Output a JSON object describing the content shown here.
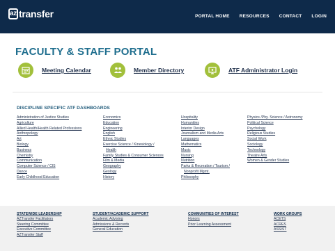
{
  "header": {
    "logo_box": "az",
    "logo_text": "transfer",
    "nav": [
      "PORTAL HOME",
      "RESOURCES",
      "CONTACT",
      "LOGIN"
    ]
  },
  "page_title": "FACULTY & STAFF PORTAL",
  "quick_links": [
    {
      "label": "Meeting Calendar",
      "icon": "calendar-icon"
    },
    {
      "label": "Member Directory",
      "icon": "people-icon"
    },
    {
      "label": "ATF Administrator Login",
      "icon": "admin-login-icon"
    }
  ],
  "dashboards": {
    "title": "DISCIPLINE SPECIFIC ATF DASHBOARDS",
    "columns": [
      [
        "Administration of Justice Studies",
        "Agriculture",
        "Allied Health/Health Related Professions",
        "Anthropology",
        "Art",
        "Biology",
        "Business",
        "Chemistry",
        "Communication",
        "Computer Science / CIS",
        "Dance",
        "Early Childhood Education"
      ],
      [
        "Economics",
        "Education",
        "Engineering",
        "English",
        "Ethnic Studies",
        "Exercise Science / Kinesiology /",
        "Health",
        "Family Studies & Consumer Sciences",
        "Film & Media",
        "Geography",
        "Geology",
        "History"
      ],
      [
        "Hospitality",
        "Humanities",
        "Interior Design",
        "Journalism and Media Arts",
        "Languages",
        "Mathematics",
        "Music",
        "Nursing",
        "Nutrition",
        "Parks & Recreation / Tourism /",
        "Nonprofit Mgmt.",
        "Philosophy"
      ],
      [
        "Physics /Phy. Science / Astronomy",
        "Political Science",
        "Psychology",
        "Religious Studies",
        "Social Work",
        "Sociology",
        "Technology",
        "Theatre Arts",
        "Women & Gender Studies"
      ]
    ]
  },
  "footer_groups": [
    {
      "heading": "STATEWIDE LEADERSHIP",
      "items": [
        "AZTransfer Facilitators",
        "Steering Committee",
        "Executive Committee",
        "AZTransfer Staff"
      ]
    },
    {
      "heading": "STUDENT/ACADEMIC SUPPORT",
      "items": [
        "Academic Advising",
        "Admissions & Records",
        "General Education"
      ]
    },
    {
      "heading": "COMMUNITIES OF INTEREST",
      "items": [
        "Honors",
        "Prior Learning Assessment"
      ]
    },
    {
      "heading": "WORK GROUPS",
      "items": [
        "ACETS",
        "ACRES",
        "ASSIST"
      ]
    }
  ],
  "colors": {
    "header_bg": "#0e2a4a",
    "title": "#1f6e8e",
    "icon_green": "#a2c03b"
  }
}
